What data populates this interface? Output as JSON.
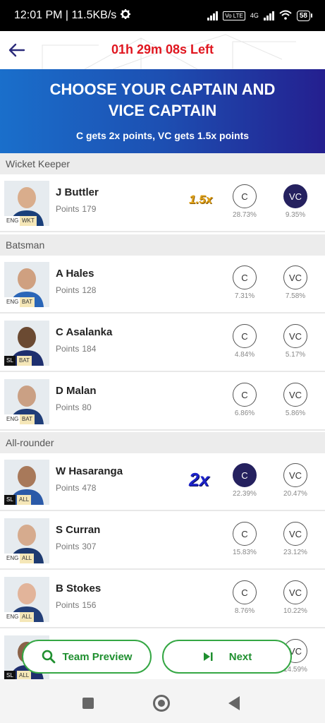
{
  "status_bar": {
    "time_speed": "12:01 PM | 11.5KB/s",
    "network_label": "4G",
    "volte_label": "Vo LTE",
    "battery": "58"
  },
  "header": {
    "timer": "01h 29m 08s Left"
  },
  "banner": {
    "title": "CHOOSE YOUR CAPTAIN AND VICE CAPTAIN",
    "subtitle": "C gets 2x points, VC gets 1.5x points"
  },
  "labels": {
    "points": "Points",
    "c": "C",
    "vc": "VC"
  },
  "sections": {
    "wicket_keeper": "Wicket Keeper",
    "batsman": "Batsman",
    "all_rounder": "All-rounder"
  },
  "multipliers": {
    "vc": "1.5x",
    "c": "2x"
  },
  "players": [
    {
      "name": "J Buttler",
      "points": "179",
      "team": "ENG",
      "role": "WKT",
      "c_pct": "28.73%",
      "vc_pct": "9.35%",
      "selected": "vc"
    },
    {
      "name": "A Hales",
      "points": "128",
      "team": "ENG",
      "role": "BAT",
      "c_pct": "7.31%",
      "vc_pct": "7.58%",
      "selected": ""
    },
    {
      "name": "C Asalanka",
      "points": "184",
      "team": "SL",
      "role": "BAT",
      "c_pct": "4.84%",
      "vc_pct": "5.17%",
      "selected": ""
    },
    {
      "name": "D Malan",
      "points": "80",
      "team": "ENG",
      "role": "BAT",
      "c_pct": "6.86%",
      "vc_pct": "5.86%",
      "selected": ""
    },
    {
      "name": "W Hasaranga",
      "points": "478",
      "team": "SL",
      "role": "ALL",
      "c_pct": "22.39%",
      "vc_pct": "20.47%",
      "selected": "c"
    },
    {
      "name": "S Curran",
      "points": "307",
      "team": "ENG",
      "role": "ALL",
      "c_pct": "15.83%",
      "vc_pct": "23.12%",
      "selected": ""
    },
    {
      "name": "B Stokes",
      "points": "156",
      "team": "ENG",
      "role": "ALL",
      "c_pct": "8.76%",
      "vc_pct": "10.22%",
      "selected": ""
    },
    {
      "name": "",
      "points": "",
      "team": "SL",
      "role": "ALL",
      "c_pct": "",
      "vc_pct": "14.59%",
      "selected": ""
    }
  ],
  "actions": {
    "team_preview": "Team Preview",
    "next": "Next"
  },
  "colors": {
    "accent_green": "#35a744",
    "timer_red": "#e0161f",
    "selected_navy": "#25215f",
    "banner_start": "#1a6fcb",
    "banner_end": "#241f8f"
  },
  "icons": {
    "back": "arrow-left-icon",
    "preview": "search-icon",
    "next": "skip-next-icon",
    "settings": "gear-icon",
    "wifi": "wifi-icon"
  }
}
